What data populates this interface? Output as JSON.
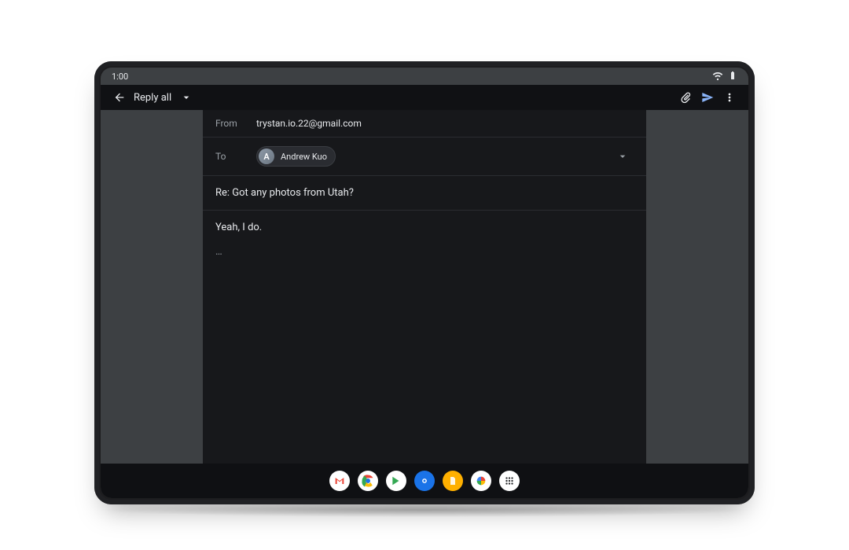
{
  "status": {
    "time": "1:00"
  },
  "appbar": {
    "title": "Reply all"
  },
  "compose": {
    "from_label": "From",
    "from_value": "trystan.io.22@gmail.com",
    "to_label": "To",
    "recipient_name": "Andrew Kuo",
    "recipient_initial": "A",
    "subject": "Re: Got any photos from Utah?",
    "body": "Yeah, I do.",
    "quoted_indicator": "…"
  },
  "taskbar": {
    "apps": [
      "gmail",
      "chrome",
      "play",
      "camera",
      "files",
      "photos",
      "all-apps"
    ]
  }
}
